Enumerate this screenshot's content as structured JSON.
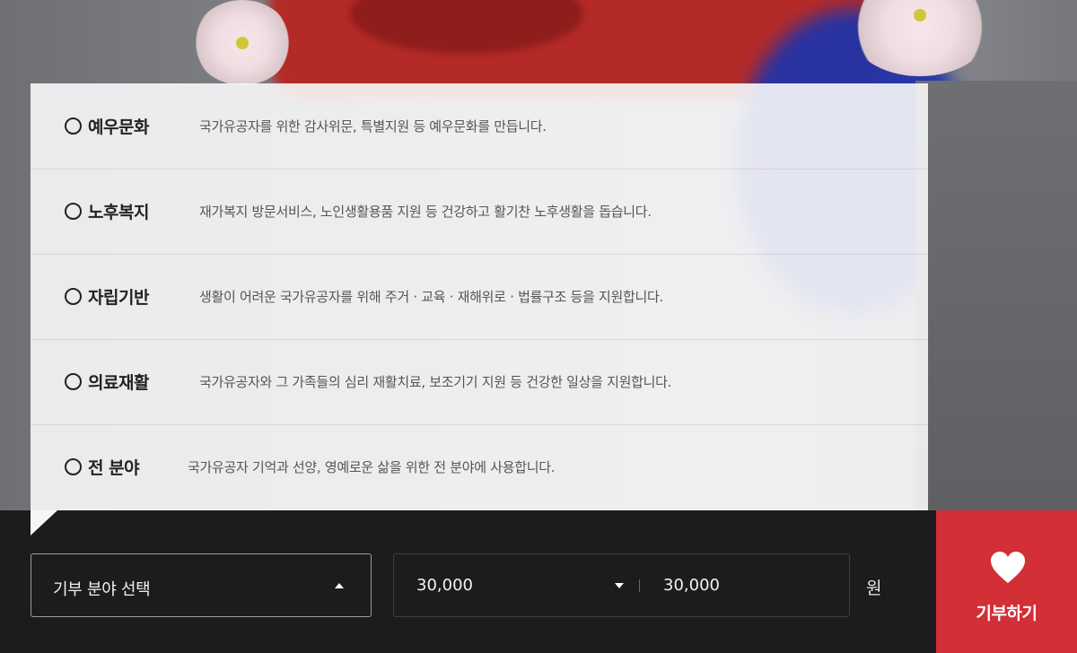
{
  "categories": [
    {
      "label": "예우문화",
      "description": "국가유공자를 위한 감사위문, 특별지원 등 예우문화를 만듭니다."
    },
    {
      "label": "노후복지",
      "description": "재가복지 방문서비스, 노인생활용품 지원 등 건강하고 활기찬 노후생활을 돕습니다."
    },
    {
      "label": "자립기반",
      "description": "생활이 어려운 국가유공자를 위해 주거 · 교육 · 재해위로 · 법률구조 등을 지원합니다."
    },
    {
      "label": "의료재활",
      "description": "국가유공자와 그 가족들의 심리 재활치료, 보조기기 지원 등 건강한 일상을 지원합니다."
    },
    {
      "label": "전 분야",
      "description": "국가유공자 기억과 선양, 영예로운 삶을 위한 전 분야에 사용합니다."
    }
  ],
  "donation_bar": {
    "category_select": "기부 분야 선택",
    "amount_select": "30,000",
    "amount_input": "30,000",
    "currency_unit": "원",
    "donate_label": "기부하기"
  },
  "icons": {
    "radio": "radio-empty-icon",
    "caret_up": "caret-up-icon",
    "caret_down": "caret-down-icon",
    "heart": "heart-icon"
  },
  "colors": {
    "accent": "#d32f36",
    "bar": "#1c1c1e"
  }
}
